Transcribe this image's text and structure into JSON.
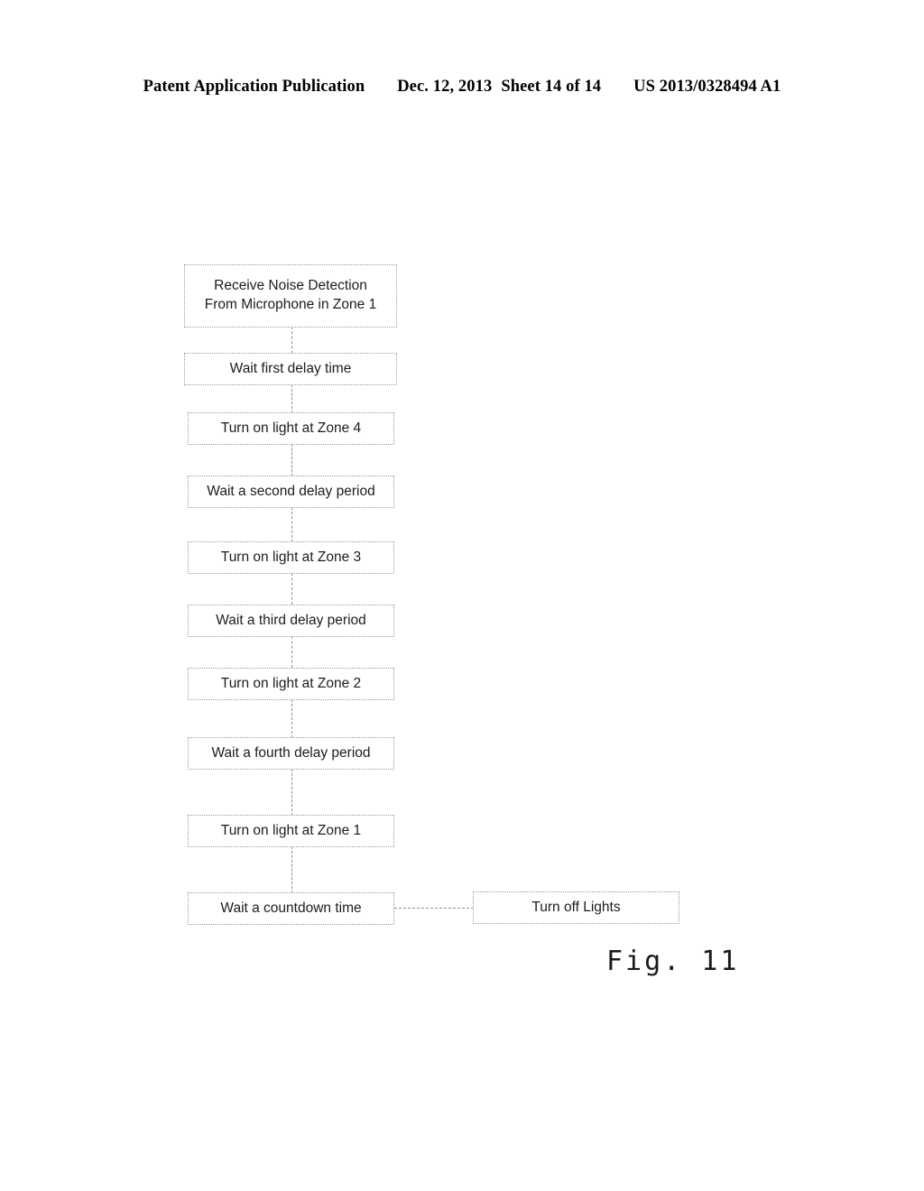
{
  "page": {
    "header": {
      "publication": "Patent Application Publication",
      "date": "Dec. 12, 2013",
      "sheet": "Sheet 14 of 14",
      "patent_number": "US 2013/0328494 A1"
    },
    "figure_caption": "Fig. 11"
  },
  "flowchart": {
    "nodes": [
      {
        "id": "receive-noise-detection",
        "label": "Receive Noise Detection\nFrom Microphone in Zone 1"
      },
      {
        "id": "wait-first-delay-time",
        "label": "Wait first delay time"
      },
      {
        "id": "turn-on-light-zone-4",
        "label": "Turn on light at Zone 4"
      },
      {
        "id": "wait-second-delay-period",
        "label": "Wait a second delay period"
      },
      {
        "id": "turn-on-light-zone-3",
        "label": "Turn on light at Zone 3"
      },
      {
        "id": "wait-third-delay-period",
        "label": "Wait a third delay period"
      },
      {
        "id": "turn-on-light-zone-2",
        "label": "Turn on light at Zone 2"
      },
      {
        "id": "wait-fourth-delay-period",
        "label": "Wait a fourth delay period"
      },
      {
        "id": "turn-on-light-zone-1",
        "label": "Turn on light at Zone 1"
      },
      {
        "id": "wait-countdown-time",
        "label": "Wait a countdown time"
      },
      {
        "id": "turn-off-lights",
        "label": "Turn off Lights"
      }
    ],
    "colors": {
      "box_border": "#9a9a9a",
      "connector": "#8e8e8e",
      "text": "#1c1c1c",
      "background": "#ffffff"
    }
  }
}
